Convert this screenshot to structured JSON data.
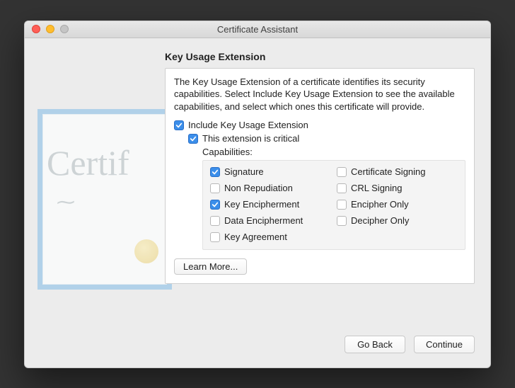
{
  "window": {
    "title": "Certificate Assistant"
  },
  "heading": "Key Usage Extension",
  "description": "The Key Usage Extension of a certificate identifies its security capabilities. Select Include Key Usage Extension to see the available capabilities, and select which ones this certificate will provide.",
  "include": {
    "label": "Include Key Usage Extension",
    "checked": true
  },
  "critical": {
    "label": "This extension is critical",
    "checked": true
  },
  "capabilities_label": "Capabilities:",
  "capabilities": {
    "signature": {
      "label": "Signature",
      "checked": true
    },
    "cert_signing": {
      "label": "Certificate Signing",
      "checked": false
    },
    "non_repudiation": {
      "label": "Non Repudiation",
      "checked": false
    },
    "crl_signing": {
      "label": "CRL Signing",
      "checked": false
    },
    "key_encipherment": {
      "label": "Key Encipherment",
      "checked": true
    },
    "encipher_only": {
      "label": "Encipher Only",
      "checked": false
    },
    "data_encipherment": {
      "label": "Data Encipherment",
      "checked": false
    },
    "decipher_only": {
      "label": "Decipher Only",
      "checked": false
    },
    "key_agreement": {
      "label": "Key Agreement",
      "checked": false
    }
  },
  "buttons": {
    "learn_more": "Learn More...",
    "go_back": "Go Back",
    "continue": "Continue"
  }
}
